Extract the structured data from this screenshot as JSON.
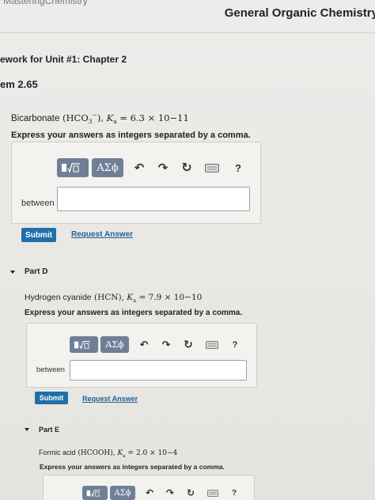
{
  "header": {
    "top_link": "MasteringChemistry",
    "course_title": "General Organic Chemistry"
  },
  "assignment_title": "ework for Unit #1: Chapter 2",
  "problem_title": "em 2.65",
  "parts": [
    {
      "part_label": "",
      "compound": "Bicarbonate",
      "formula": "HCO3−",
      "ka_value": "6.3 × 10−11",
      "instruction": "Express your answers as integers separated by a comma.",
      "field_label": "between",
      "input_value": "",
      "submit_label": "Submit",
      "request_label": "Request Answer"
    },
    {
      "part_label": "Part D",
      "compound": "Hydrogen cyanide",
      "formula": "HCN",
      "ka_value": "7.9 × 10−10",
      "instruction": "Express your answers as integers separated by a comma.",
      "field_label": "between",
      "input_value": "",
      "submit_label": "Submit",
      "request_label": "Request Answer"
    },
    {
      "part_label": "Part E",
      "compound": "Formic acid",
      "formula": "HCOOH",
      "ka_value": "2.0 × 10−4",
      "instruction": "Express your answers as integers separated by a comma."
    }
  ],
  "toolbar": {
    "templates_icon": "templates-icon",
    "greek_label": "ΑΣϕ",
    "undo_icon": "undo-icon",
    "redo_icon": "redo-icon",
    "reset_icon": "reset-icon",
    "keyboard_icon": "keyboard-icon",
    "help_label": "?"
  },
  "colors": {
    "toolbar_button": "#6f7f95",
    "submit_button": "#1f6fa8",
    "link": "#1e5f95"
  }
}
